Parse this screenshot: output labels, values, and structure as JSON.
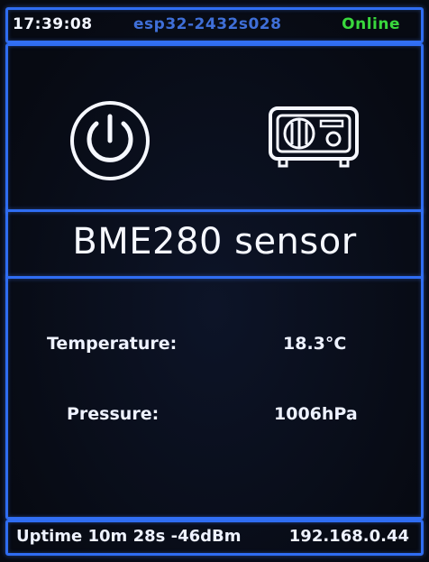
{
  "status": {
    "time": "17:39:08",
    "device_id": "esp32-2432s028",
    "connection": "Online"
  },
  "icons": {
    "left": "power-icon",
    "right": "radio-icon"
  },
  "title": "BME280 sensor",
  "readings": {
    "temperature_label": "Temperature:",
    "temperature_value": "18.3°C",
    "pressure_label": "Pressure:",
    "pressure_value": "1006hPa"
  },
  "footer": {
    "uptime_text": "Uptime 10m 28s -46dBm",
    "ip": "192.168.0.44"
  },
  "colors": {
    "accent": "#2f6df2",
    "online": "#39d83d",
    "device_text": "#3f6fd8",
    "text": "#f3f6ff",
    "background": "#0b0e14"
  }
}
